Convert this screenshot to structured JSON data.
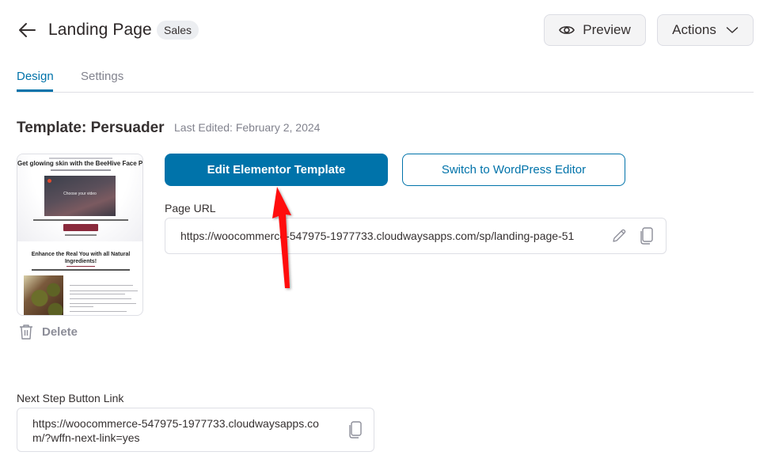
{
  "header": {
    "title": "Landing Page",
    "badge": "Sales",
    "preview_label": "Preview",
    "actions_label": "Actions",
    "back_icon": "arrow-left-icon",
    "preview_icon": "eye-icon",
    "actions_icon": "chevron-down-icon"
  },
  "tabs": [
    {
      "label": "Design",
      "active": true
    },
    {
      "label": "Settings",
      "active": false
    }
  ],
  "template": {
    "title": "Template: Persuader",
    "last_edited": "Last Edited: February 2, 2024",
    "thumbnail": {
      "headline": "Get glowing skin with the BeeHive Face Pack",
      "video_text": "Choose your video",
      "section_heading": "Enhance the Real You with all Natural Ingredients!"
    },
    "delete_label": "Delete",
    "delete_icon": "trash-icon"
  },
  "actions": {
    "edit_elementor_label": "Edit Elementor Template",
    "switch_wp_label": "Switch to WordPress Editor"
  },
  "page_url": {
    "label": "Page URL",
    "value": "https://woocommerce-547975-1977733.cloudwaysapps.com/sp/landing-page-51",
    "edit_icon": "pencil-icon",
    "copy_icon": "copy-icon"
  },
  "next_step": {
    "label": "Next Step Button Link",
    "value": "https://woocommerce-547975-1977733.cloudwaysapps.com/?wffn-next-link=yes",
    "copy_icon": "copy-icon"
  },
  "colors": {
    "accent": "#0073aa",
    "text": "#353030",
    "muted": "#82838e",
    "annotation": "#ff0000"
  }
}
